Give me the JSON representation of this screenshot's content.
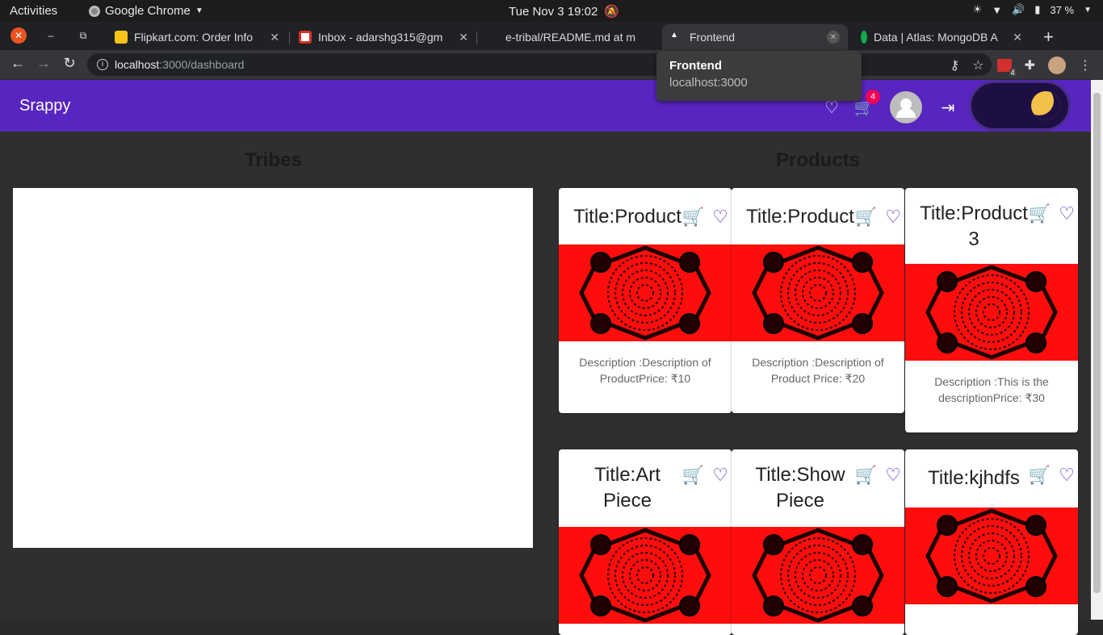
{
  "gnome": {
    "activities": "Activities",
    "app_name": "Google Chrome",
    "clock": "Tue Nov 3  19:02",
    "battery": "37 %"
  },
  "tabs": [
    {
      "title": "Flipkart.com: Order Info",
      "favicon_color": "#f7c21a"
    },
    {
      "title": "Inbox - adarshg315@gm",
      "favicon_color": "#d93025"
    },
    {
      "title": "e-tribal/README.md at m",
      "favicon_color": "#202124"
    },
    {
      "title": "Frontend",
      "favicon_color": "#202124",
      "active": true
    },
    {
      "title": "Data | Atlas: MongoDB A",
      "favicon_color": "#13aa52"
    }
  ],
  "omnibox": {
    "host": "localhost",
    "path": ":3000/dashboard"
  },
  "extension_badge": "4",
  "tooltip": {
    "title": "Frontend",
    "url": "localhost:3000"
  },
  "app": {
    "brand": "Srappy",
    "cart_count": "4",
    "primary_color": "#5725c0"
  },
  "sections": {
    "tribes": "Tribes",
    "products": "Products"
  },
  "products": [
    {
      "title": "Title:Product",
      "description": "Description :Description of ProductPrice: ₹10"
    },
    {
      "title": "Title:Product",
      "description": "Description :Description of Product Price: ₹20"
    },
    {
      "title": "Title:Product 3",
      "description": "Description :This is the descriptionPrice: ₹30"
    },
    {
      "title": "Title:Art Piece",
      "description": ""
    },
    {
      "title": "Title:Show Piece",
      "description": ""
    },
    {
      "title": "Title:kjhdfs",
      "description": ""
    }
  ]
}
